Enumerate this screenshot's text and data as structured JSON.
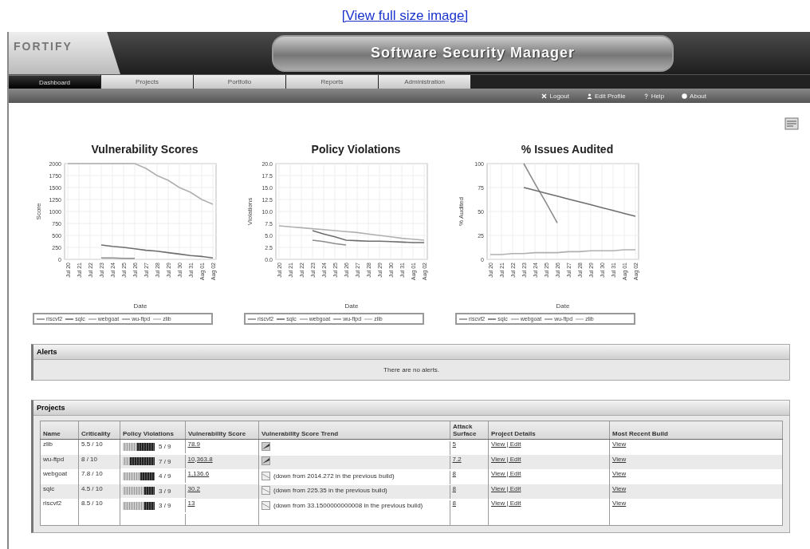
{
  "top_link": "[View full size image]",
  "header": {
    "logo": "FORTIFY",
    "title": "Software Security Manager"
  },
  "tabs": [
    {
      "label": "Dashboard",
      "selected": true
    },
    {
      "label": "Projects",
      "selected": false
    },
    {
      "label": "Portfolio",
      "selected": false
    },
    {
      "label": "Reports",
      "selected": false
    },
    {
      "label": "Administration",
      "selected": false
    }
  ],
  "user_links": [
    {
      "label": "Logout",
      "kind": "logout"
    },
    {
      "label": "Edit Profile",
      "kind": "profile"
    },
    {
      "label": "Help",
      "kind": "help"
    },
    {
      "label": "About",
      "kind": "about"
    }
  ],
  "charts": [
    {
      "chart_data": {
        "type": "line",
        "grid": true,
        "legend": "bottom",
        "title": "Vulnerability Scores",
        "xlabel": "Date",
        "ylabel": "Score",
        "categories": [
          "Jul 20",
          "Jul 21",
          "Jul 22",
          "Jul 23",
          "Jul 24",
          "Jul 25",
          "Jul 26",
          "Jul 27",
          "Jul 28",
          "Jul 29",
          "Jul 30",
          "Jul 31",
          "Aug 01",
          "Aug 02"
        ],
        "ylim": [
          0,
          2000
        ],
        "yticks": [
          0,
          250,
          500,
          750,
          1000,
          1250,
          1500,
          1750,
          2000
        ],
        "series": [
          {
            "name": "riscvf2",
            "color": "#8c8c8c",
            "values": [
              null,
              null,
              null,
              30,
              30,
              20,
              20,
              null,
              null,
              null,
              null,
              null,
              null,
              null
            ]
          },
          {
            "name": "sqlc",
            "color": "#6e6e6e",
            "values": [
              null,
              null,
              null,
              300,
              270,
              250,
              220,
              190,
              170,
              140,
              110,
              80,
              60,
              30
            ]
          },
          {
            "name": "webgoat",
            "color": "#b0b0b0",
            "values": [
              2000,
              2000,
              2000,
              2000,
              2000,
              2000,
              2000,
              1900,
              1750,
              1650,
              1500,
              1400,
              1250,
              1150
            ]
          },
          {
            "name": "wu-ftpd",
            "color": "#9a9a9a",
            "values": [
              null,
              null,
              null,
              null,
              null,
              null,
              null,
              null,
              null,
              null,
              null,
              null,
              null,
              null
            ]
          },
          {
            "name": "zlib",
            "color": "#c4c4c4",
            "values": [
              null,
              null,
              null,
              null,
              null,
              null,
              null,
              null,
              null,
              null,
              null,
              null,
              null,
              null
            ]
          }
        ]
      }
    },
    {
      "chart_data": {
        "type": "line",
        "grid": true,
        "legend": "bottom",
        "title": "Policy Violations",
        "xlabel": "Date",
        "ylabel": "Violations",
        "categories": [
          "Jul 20",
          "Jul 21",
          "Jul 22",
          "Jul 23",
          "Jul 24",
          "Jul 25",
          "Jul 26",
          "Jul 27",
          "Jul 28",
          "Jul 29",
          "Jul 30",
          "Jul 31",
          "Aug 01",
          "Aug 02"
        ],
        "ylim": [
          0,
          20
        ],
        "yticks": [
          {
            "value": 0,
            "label": "0.0"
          },
          {
            "value": 2.5,
            "label": "2.5"
          },
          {
            "value": 5,
            "label": "5.0"
          },
          {
            "value": 7.5,
            "label": "7.5"
          },
          {
            "value": 10,
            "label": "10.0"
          },
          {
            "value": 12.5,
            "label": "12.5"
          },
          {
            "value": 15,
            "label": "15.0"
          },
          {
            "value": 17.5,
            "label": "17.5"
          },
          {
            "value": 20,
            "label": "20.0"
          }
        ],
        "series": [
          {
            "name": "riscvf2",
            "color": "#8c8c8c",
            "values": [
              null,
              null,
              null,
              4,
              3.7,
              3.3,
              3,
              null,
              null,
              null,
              null,
              null,
              null,
              null
            ]
          },
          {
            "name": "sqlc",
            "color": "#6e6e6e",
            "values": [
              null,
              null,
              null,
              6,
              5.3,
              4.7,
              4,
              3.9,
              3.8,
              3.8,
              3.7,
              3.6,
              3.5,
              3.5
            ]
          },
          {
            "name": "webgoat",
            "color": "#b0b0b0",
            "values": [
              7,
              6.8,
              6.6,
              6.4,
              6.2,
              6,
              5.8,
              5.6,
              5.3,
              5,
              4.7,
              4.4,
              4.2,
              4
            ]
          },
          {
            "name": "wu-ftpd",
            "color": "#9a9a9a",
            "values": [
              null,
              null,
              null,
              null,
              null,
              null,
              null,
              null,
              null,
              null,
              null,
              null,
              null,
              null
            ]
          },
          {
            "name": "zlib",
            "color": "#c4c4c4",
            "values": [
              null,
              null,
              null,
              null,
              null,
              null,
              null,
              null,
              null,
              null,
              null,
              null,
              null,
              null
            ]
          }
        ]
      }
    },
    {
      "chart_data": {
        "type": "line",
        "grid": true,
        "legend": "bottom",
        "title": "% Issues Audited",
        "xlabel": "Date",
        "ylabel": "% Audited",
        "categories": [
          "Jul 20",
          "Jul 21",
          "Jul 22",
          "Jul 23",
          "Jul 24",
          "Jul 25",
          "Jul 26",
          "Jul 27",
          "Jul 28",
          "Jul 29",
          "Jul 30",
          "Jul 31",
          "Aug 01",
          "Aug 02"
        ],
        "ylim": [
          0,
          100
        ],
        "yticks": [
          0,
          25,
          50,
          75,
          100
        ],
        "series": [
          {
            "name": "riscvf2",
            "color": "#8c8c8c",
            "values": [
              null,
              null,
              null,
              100,
              79,
              59,
              38,
              null,
              null,
              null,
              null,
              null,
              null,
              null
            ]
          },
          {
            "name": "sqlc",
            "color": "#6e6e6e",
            "values": [
              null,
              null,
              null,
              75,
              72,
              69,
              66,
              63,
              60,
              57,
              54,
              51,
              48,
              45
            ]
          },
          {
            "name": "webgoat",
            "color": "#b0b0b0",
            "values": [
              5,
              5,
              6,
              6,
              7,
              7,
              7,
              8,
              8,
              9,
              9,
              9,
              10,
              10
            ]
          },
          {
            "name": "wu-ftpd",
            "color": "#9a9a9a",
            "values": [
              null,
              null,
              null,
              null,
              null,
              null,
              null,
              null,
              null,
              null,
              null,
              null,
              null,
              null
            ]
          },
          {
            "name": "zlib",
            "color": "#c4c4c4",
            "values": [
              null,
              null,
              null,
              null,
              null,
              null,
              null,
              null,
              null,
              null,
              null,
              null,
              null,
              null
            ]
          }
        ]
      }
    }
  ],
  "alerts": {
    "title": "Alerts",
    "message": "There are no alerts."
  },
  "projects": {
    "title": "Projects",
    "columns": [
      "Name",
      "Criticality",
      "Policy Violations",
      "Vulnerability Score",
      "Vulnerability Score Trend",
      "Attack Surface",
      "Project Details",
      "Most Recent Build"
    ],
    "rows": [
      {
        "name": "zlib",
        "criticality": "5.5 / 10",
        "level": 0.56,
        "violations": "5 / 9",
        "score": "78.9",
        "kind": "up",
        "attack_surface": "5",
        "details": "View | Edit",
        "build": "View"
      },
      {
        "name": "wu-ftpd",
        "criticality": "8 / 10",
        "level": 0.78,
        "violations": "7 / 9",
        "score": "10,363.8",
        "kind": "up",
        "attack_surface": "7.2",
        "details": "View | Edit",
        "build": "View"
      },
      {
        "name": "webgoat",
        "criticality": "7.8 / 10",
        "level": 0.44,
        "violations": "4 / 9",
        "score": "1,136.6",
        "kind": "down",
        "trend_note": "(down from 2014.272 in the previous build)",
        "attack_surface": "8",
        "details": "View | Edit",
        "build": "View"
      },
      {
        "name": "sqlc",
        "criticality": "4.5 / 10",
        "level": 0.33,
        "violations": "3 / 9",
        "score": "30.2",
        "kind": "down",
        "trend_note": "(down from 225.35 in the previous build)",
        "attack_surface": "8",
        "details": "View | Edit",
        "build": "View"
      },
      {
        "name": "riscvf2",
        "criticality": "8.5 / 10",
        "level": 0.33,
        "violations": "3 / 9",
        "score": "13",
        "kind": "down",
        "trend_note": "(down from 33.1500000000008 in the previous build)",
        "attack_surface": "8",
        "details": "View | Edit",
        "build": "View"
      }
    ]
  }
}
